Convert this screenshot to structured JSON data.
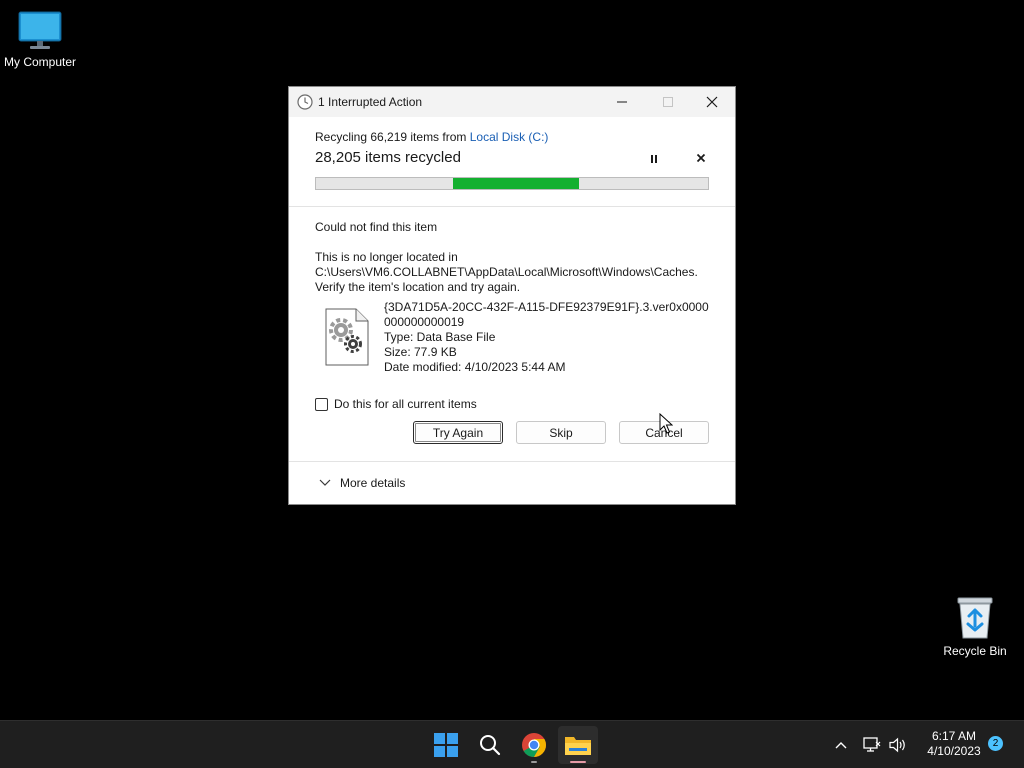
{
  "desktop": {
    "icons": [
      {
        "label": "My Computer"
      },
      {
        "label": "Recycle Bin"
      }
    ]
  },
  "dialog": {
    "title": "1 Interrupted Action",
    "progress": {
      "recycling_prefix": "Recycling 66,219 items from ",
      "source_link": "Local Disk (C:)",
      "count_text": "28,205 items recycled",
      "indeterminate_segment_start": 0.35,
      "indeterminate_segment_end": 0.67
    },
    "error": {
      "title": "Could not find this item",
      "line1": "This is no longer located in",
      "line2": "C:\\Users\\VM6.COLLABNET\\AppData\\Local\\Microsoft\\Windows\\Caches.",
      "line3": "Verify the item's location and try again."
    },
    "file": {
      "name": "{3DA71D5A-20CC-432F-A115-DFE92379E91F}.3.ver0x0000000000000019",
      "type": "Type: Data Base File",
      "size": "Size: 77.9 KB",
      "modified": "Date modified: 4/10/2023 5:44 AM"
    },
    "checkbox_label": "Do this for all current items",
    "buttons": {
      "try_again": "Try Again",
      "skip": "Skip",
      "cancel": "Cancel"
    },
    "more_details": "More details"
  },
  "taskbar": {
    "apps": [
      "start-icon",
      "search-icon",
      "chrome-icon",
      "file-explorer-icon"
    ],
    "clock": {
      "time": "6:17 AM",
      "date": "4/10/2023"
    },
    "notification_count": "2"
  },
  "colors": {
    "progress_fill": "#14b030",
    "link": "#1a5fb4",
    "taskbar": "#1f1f1f",
    "badge": "#4cc2ff"
  }
}
